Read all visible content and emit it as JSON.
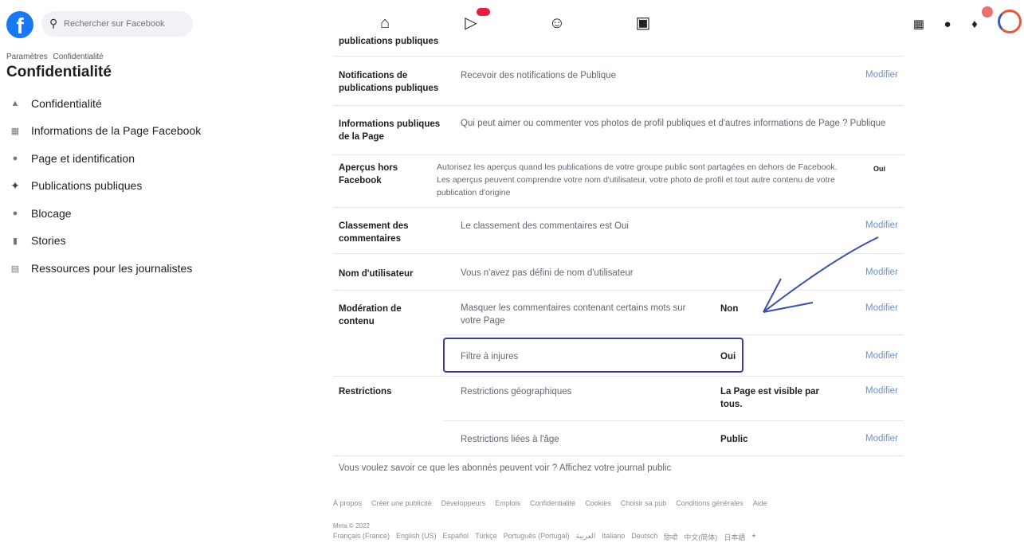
{
  "header": {
    "search_placeholder": "Rechercher sur Facebook",
    "nav": [
      "home-icon",
      "watch-icon",
      "groups-icon",
      "gaming-icon"
    ],
    "right": [
      "menu-grid-icon",
      "messenger-icon",
      "notifications-icon",
      "avatar"
    ]
  },
  "sidebar": {
    "breadcrumb": [
      "Paramètres",
      "Confidentialité"
    ],
    "title": "Confidentialité",
    "items": [
      {
        "label": "Confidentialité",
        "icon": "lock-icon"
      },
      {
        "label": "Informations de la Page Facebook",
        "icon": "info-icon"
      },
      {
        "label": "Page et identification",
        "icon": "tag-icon"
      },
      {
        "label": "Publications publiques",
        "icon": "globe-icon"
      },
      {
        "label": "Blocage",
        "icon": "block-icon"
      },
      {
        "label": "Stories",
        "icon": "stories-icon"
      },
      {
        "label": "Ressources pour les journalistes",
        "icon": "news-icon"
      }
    ]
  },
  "settings": {
    "top_cutoff_label": "publications publiques",
    "edit_label": "Modifier",
    "rows": [
      {
        "label": "Notifications de publications publiques",
        "desc": "Recevoir des notifications de Publique"
      },
      {
        "label": "Informations publiques de la Page",
        "desc": "Qui peut aimer ou commenter vos photos de profil publiques et d'autres informations de Page ? Publique"
      },
      {
        "label": "Aperçus hors Facebook",
        "desc": "Autorisez les aperçus quand les publications de votre groupe public sont partagées en dehors de Facebook. Les aperçus peuvent comprendre votre nom d'utilisateur, votre photo de profil et tout autre contenu de votre publication d'origine",
        "value": "Oui"
      },
      {
        "label": "Classement des commentaires",
        "desc": "Le classement des commentaires est Oui"
      },
      {
        "label": "Nom d'utilisateur",
        "desc": "Vous n'avez pas défini de nom d'utilisateur"
      },
      {
        "label": "Modération de contenu",
        "desc": "Masquer les commentaires contenant certains mots sur votre Page",
        "value": "Non"
      },
      {
        "label": "",
        "desc": "Filtre à injures",
        "value": "Oui"
      },
      {
        "label": "Restrictions",
        "desc": "Restrictions géographiques",
        "value": "La Page est visible par tous."
      },
      {
        "label": "",
        "desc": "Restrictions liées à l'âge",
        "value": "Public"
      }
    ],
    "public_link": "Vous voulez savoir ce que les abonnés peuvent voir ? Affichez votre journal public"
  },
  "footer": {
    "links": [
      "À propos",
      "Créer une publicité",
      "Développeurs",
      "Emplois",
      "Confidentialité",
      "Cookies",
      "Choisir sa pub",
      "Conditions générales",
      "Aide"
    ],
    "meta": "Meta © 2022",
    "languages": [
      "Français (France)",
      "English (US)",
      "Español",
      "Türkçe",
      "Português (Portugal)",
      "العربية",
      "Italiano",
      "Deutsch",
      "हिन्दी",
      "中文(简体)",
      "日本語"
    ],
    "plus": "+"
  },
  "colors": {
    "brand": "#1877f2",
    "link": "#6d8fc6",
    "highlight_box": "#3b3d8f",
    "arrow": "#3b4fa8"
  }
}
